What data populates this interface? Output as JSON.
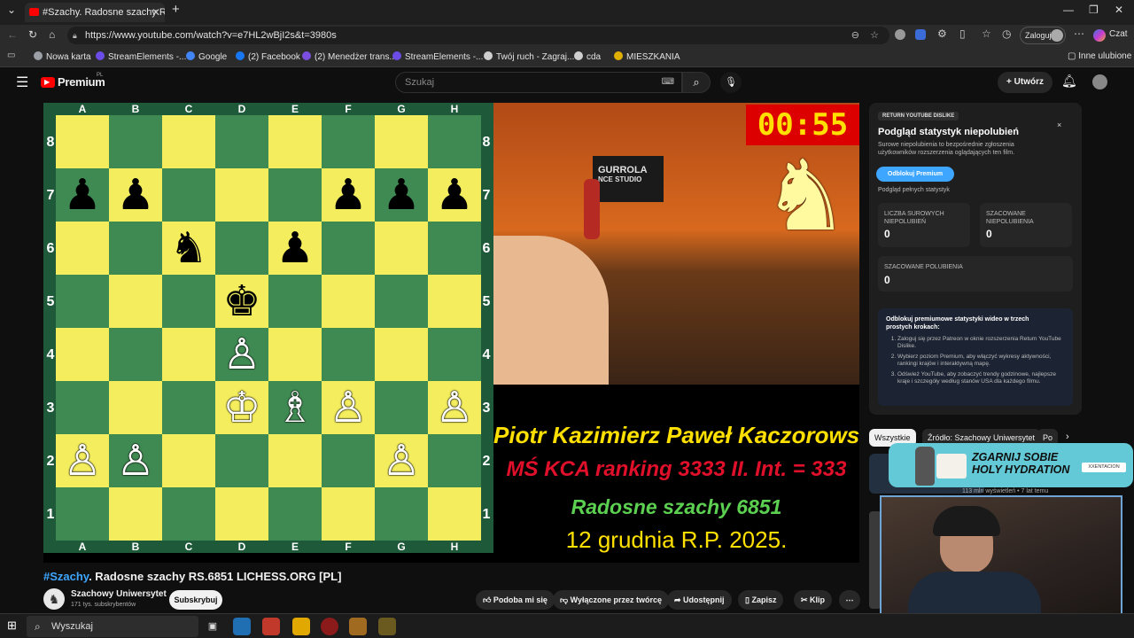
{
  "browser": {
    "tab_title": "#Szachy. Radosne szachy RS.6851",
    "url": "https://www.youtube.com/watch?v=e7HL2wBjI2s&t=3980s",
    "login_label": "Zaloguj",
    "chat_label": "Czat",
    "bookmarks": [
      {
        "label": "Nowa karta",
        "color": "#9aa0a6"
      },
      {
        "label": "StreamElements -...",
        "color": "#6b4ce6"
      },
      {
        "label": "Google",
        "color": "#4285f4"
      },
      {
        "label": "(2) Facebook",
        "color": "#1877f2"
      },
      {
        "label": "(2) Menedżer trans...",
        "color": "#7a4fe0"
      },
      {
        "label": "StreamElements -...",
        "color": "#6b4ce6"
      },
      {
        "label": "Twój ruch - Zagraj...",
        "color": "#cfcfcf"
      },
      {
        "label": "cda",
        "color": "#cfcfcf"
      },
      {
        "label": "MIESZKANIA",
        "color": "#e0b000"
      }
    ],
    "other_bookmarks": "Inne ulubione"
  },
  "youtube": {
    "logo": "Premium",
    "logo_region": "PL",
    "search_placeholder": "Szukaj",
    "create_label": "Utwórz"
  },
  "video": {
    "timer": "00:55",
    "overlay_lines": [
      {
        "text": "Piotr Kazimierz Paweł Kaczorowski",
        "color": "#ffe000"
      },
      {
        "text": "MŚ KCA ranking 3333   II. Int. = 333",
        "color": "#e0102a"
      },
      {
        "text": "Radosne szachy 6851",
        "color": "#5cd050"
      },
      {
        "text": "12 grudnia R.P. 2025.",
        "color": "#ffe000"
      }
    ],
    "files": [
      "A",
      "B",
      "C",
      "D",
      "E",
      "F",
      "G",
      "H"
    ],
    "ranks": [
      "8",
      "7",
      "6",
      "5",
      "4",
      "3",
      "2",
      "1"
    ],
    "pieces": [
      {
        "sq": "a7",
        "glyph": "♟",
        "side": "black"
      },
      {
        "sq": "b7",
        "glyph": "♟",
        "side": "black"
      },
      {
        "sq": "f7",
        "glyph": "♟",
        "side": "black"
      },
      {
        "sq": "g7",
        "glyph": "♟",
        "side": "black"
      },
      {
        "sq": "h7",
        "glyph": "♟",
        "side": "black"
      },
      {
        "sq": "c6",
        "glyph": "♞",
        "side": "black"
      },
      {
        "sq": "e6",
        "glyph": "♟",
        "side": "black"
      },
      {
        "sq": "d5",
        "glyph": "♚",
        "side": "black"
      },
      {
        "sq": "d4",
        "glyph": "♙",
        "side": "white"
      },
      {
        "sq": "d3",
        "glyph": "♔",
        "side": "white"
      },
      {
        "sq": "e3",
        "glyph": "♗",
        "side": "white"
      },
      {
        "sq": "f3",
        "glyph": "♙",
        "side": "white"
      },
      {
        "sq": "h3",
        "glyph": "♙",
        "side": "white"
      },
      {
        "sq": "a2",
        "glyph": "♙",
        "side": "white"
      },
      {
        "sq": "b2",
        "glyph": "♙",
        "side": "white"
      },
      {
        "sq": "g2",
        "glyph": "♙",
        "side": "white"
      }
    ],
    "banner_text": "GURROLA",
    "banner_sub": "NCE STUDIO"
  },
  "ryd": {
    "badge": "RETURN YOUTUBE DISLIKE",
    "title": "Podgląd statystyk niepolubień",
    "desc": "Surowe niepolubienia to bezpośrednie zgłoszenia użytkowników rozszerzenia oglądających ten film.",
    "unlock_button": "Odblokuj Premium",
    "preview_label": "Podgląd pełnych statystyk",
    "raw_label": "LICZBA SUROWYCH NIEPOLUBIEŃ",
    "raw_value": "0",
    "est_label": "SZACOWANE NIEPOLUBIENIA",
    "est_value": "0",
    "likes_label": "SZACOWANE POLUBIENIA",
    "likes_value": "0",
    "steps_title": "Odblokuj premiumowe statystyki wideo w trzech prostych krokach:",
    "steps": [
      "Zaloguj się przez Patreon w oknie rozszerzenia Return YouTube Dislike.",
      "Wybierz poziom Premium, aby włączyć wykresy aktywności, rankingi krajów i interaktywną mapę.",
      "Odśwież YouTube, aby zobaczyć trendy godzinowe, najlepsze kraje i szczegóły według stanów USA dla każdego filmu."
    ]
  },
  "chips": {
    "all": "Wszystkie",
    "source": "Źródło: Szachowy Uniwersytet",
    "partial": "Po"
  },
  "promo": {
    "headline": "ZGARNIJ SOBIE HOLY HYDRATION",
    "brand": "XXENTACION"
  },
  "recommendation": {
    "meta": "113 mln wyświetleń • 7 lat temu"
  },
  "below": {
    "title_tag": "#Szachy",
    "title_rest": ". Radosne szachy RS.6851 LICHESS.ORG [PL]",
    "channel_name": "Szachowy Uniwersytet",
    "subscribers": "171 tys. subskrybentów",
    "subscribe": "Subskrybuj",
    "like": "Podoba mi się",
    "dislike": "Wyłączone przez twórcę",
    "share": "Udostępnij",
    "save": "Zapisz",
    "clip": "Klip"
  },
  "taskbar": {
    "search": "Wyszukaj"
  }
}
